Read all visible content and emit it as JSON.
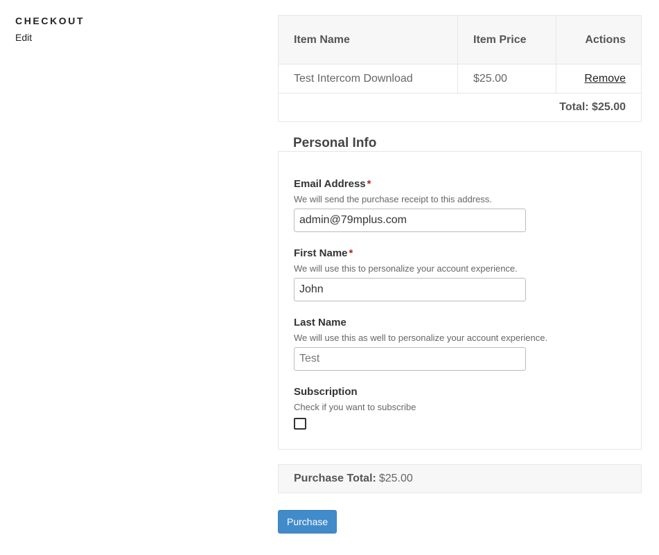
{
  "sidebar": {
    "title": "CHECKOUT",
    "edit_label": "Edit"
  },
  "cart": {
    "headers": {
      "name": "Item Name",
      "price": "Item Price",
      "actions": "Actions"
    },
    "items": [
      {
        "name": "Test Intercom Download",
        "price": "$25.00",
        "action": "Remove"
      }
    ],
    "total_label": "Total: $25.00"
  },
  "personal_info": {
    "title": "Personal Info",
    "required_mark": "*",
    "email": {
      "label": "Email Address",
      "description": "We will send the purchase receipt to this address.",
      "value": "admin@79mplus.com"
    },
    "first_name": {
      "label": "First Name",
      "description": "We will use this to personalize your account experience.",
      "value": "John"
    },
    "last_name": {
      "label": "Last Name",
      "description": "We will use this as well to personalize your account experience.",
      "placeholder": "Test"
    },
    "subscription": {
      "label": "Subscription",
      "description": "Check if you want to subscribe",
      "checked": false
    }
  },
  "purchase_total": {
    "label": "Purchase Total:",
    "amount": "$25.00"
  },
  "purchase_button": "Purchase"
}
